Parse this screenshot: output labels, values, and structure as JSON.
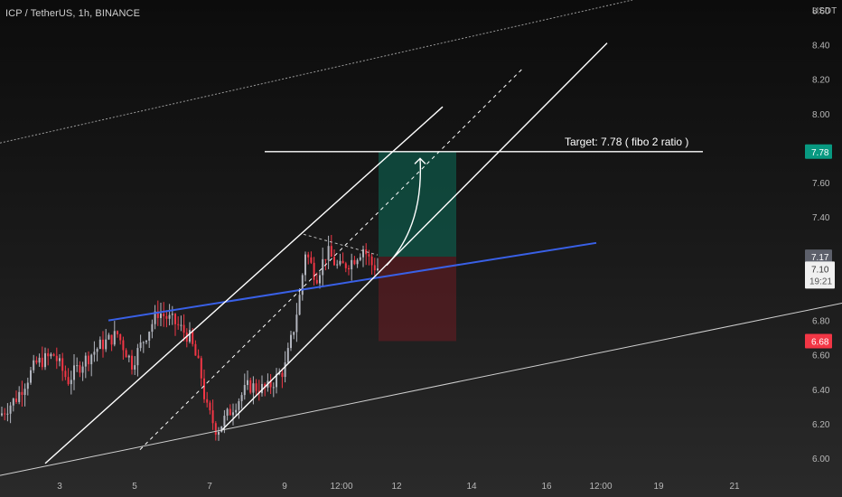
{
  "header": {
    "symbol_line": "ICP / TetherUS, 1h, BINANCE"
  },
  "price_axis": {
    "currency": "USDT",
    "ticks": [
      "6.00",
      "6.20",
      "6.40",
      "6.60",
      "6.80",
      "7.60",
      "7.40",
      "8.00",
      "8.20",
      "8.40",
      "8.60"
    ]
  },
  "time_axis": {
    "ticks": [
      "3",
      "5",
      "7",
      "9",
      "12:00",
      "12",
      "14",
      "16",
      "12:00",
      "19",
      "21"
    ]
  },
  "price_tags": {
    "target": {
      "label": "7.78",
      "price": 7.78,
      "color": "#089981"
    },
    "stop": {
      "label": "6.68",
      "price": 6.68,
      "color": "#f23645"
    },
    "current": {
      "label": "7.17",
      "price": 7.17,
      "color": "#5d606b"
    },
    "last": {
      "label": "7.10",
      "price": 7.1
    },
    "countdown": {
      "label": "19:21"
    }
  },
  "annotations": {
    "target_text": "Target: 7.78 ( fibo 2 ratio )"
  },
  "colors": {
    "up_candle": "#b2b5be",
    "down_candle": "#f23645",
    "trendline": "#3960e6",
    "channel": "#ffffff",
    "profit_zone": "#0b6e5a",
    "loss_zone": "#6e1c22"
  },
  "chart_data": {
    "type": "candlestick",
    "symbol": "ICP / TetherUS",
    "interval": "1h",
    "exchange": "BINANCE",
    "y_unit": "USDT",
    "ylim": [
      5.88,
      8.66
    ],
    "x_ticks": [
      "3",
      "5",
      "7",
      "9",
      "12:00",
      "12",
      "14",
      "16",
      "12:00",
      "19",
      "21"
    ],
    "grid": false,
    "last_price": 7.1,
    "entry_price": 7.17,
    "target_price": 7.78,
    "stop_price": 6.68,
    "trend_anchor_closes": [
      [
        0,
        6.25
      ],
      [
        18,
        6.35
      ],
      [
        40,
        6.55
      ],
      [
        60,
        6.6
      ],
      [
        75,
        6.45
      ],
      [
        90,
        6.55
      ],
      [
        110,
        6.65
      ],
      [
        130,
        6.72
      ],
      [
        146,
        6.55
      ],
      [
        160,
        6.7
      ],
      [
        175,
        6.85
      ],
      [
        195,
        6.78
      ],
      [
        210,
        6.7
      ],
      [
        222,
        6.5
      ],
      [
        228,
        6.3
      ],
      [
        240,
        6.16
      ],
      [
        258,
        6.3
      ],
      [
        275,
        6.42
      ],
      [
        295,
        6.4
      ],
      [
        315,
        6.52
      ],
      [
        325,
        6.75
      ],
      [
        332,
        6.95
      ],
      [
        338,
        7.2
      ],
      [
        350,
        7.05
      ],
      [
        362,
        7.2
      ],
      [
        375,
        7.1
      ],
      [
        390,
        7.15
      ],
      [
        402,
        7.22
      ],
      [
        412,
        7.12
      ],
      [
        420,
        7.1
      ]
    ]
  }
}
